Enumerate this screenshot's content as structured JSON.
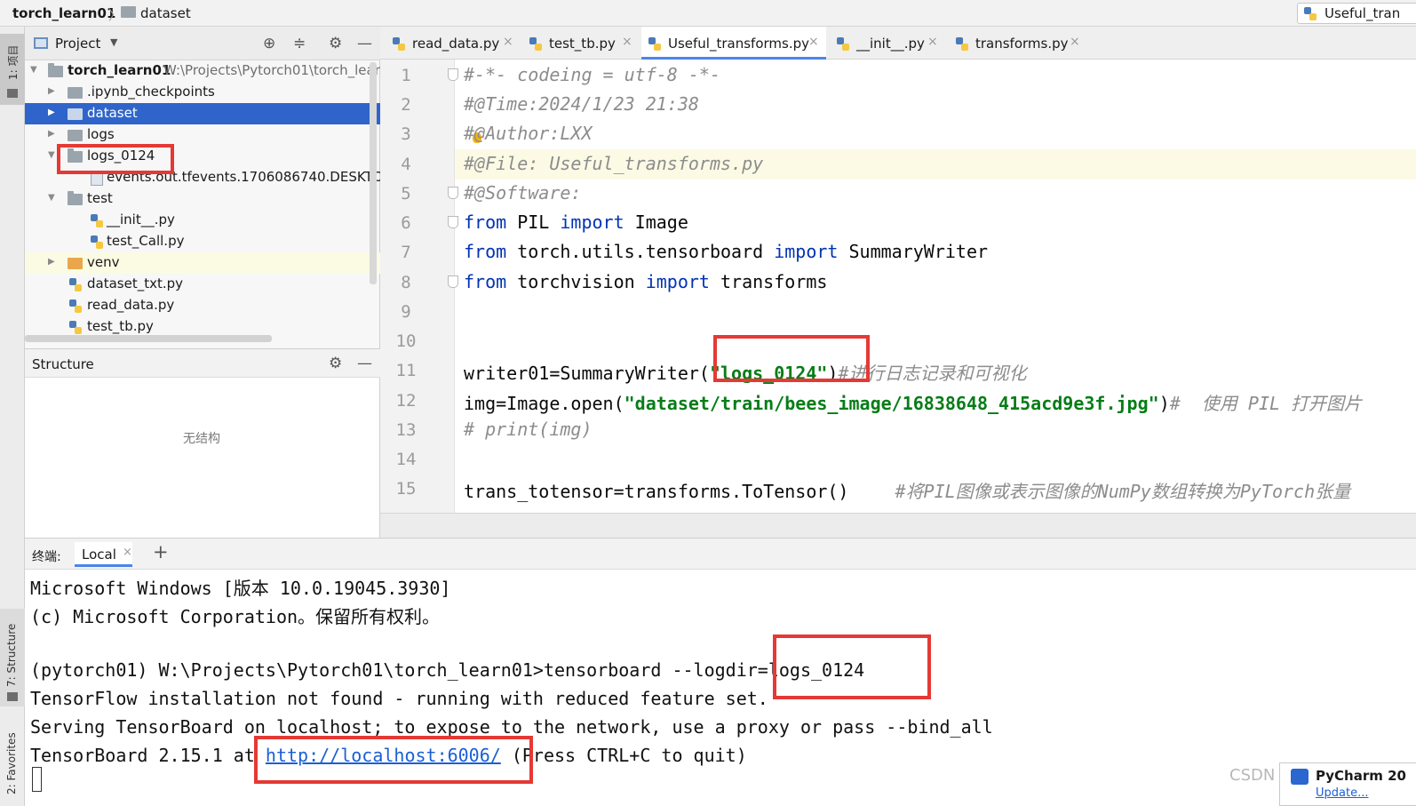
{
  "breadcrumb": {
    "project": "torch_learn01",
    "separator": "〉",
    "folder": "dataset"
  },
  "run_config": {
    "label": "Useful_tran"
  },
  "left_strip": {
    "project_tab": "1: 项目",
    "structure_tab": "7: Structure",
    "favorites_tab": "2: Favorites"
  },
  "project_panel": {
    "title": "Project",
    "tree": [
      {
        "label": "torch_learn01",
        "path": "W:\\Projects\\Pytorch01\\torch_learn",
        "type": "root"
      },
      {
        "label": ".ipynb_checkpoints",
        "type": "folder"
      },
      {
        "label": "dataset",
        "type": "folder",
        "selected": true
      },
      {
        "label": "logs",
        "type": "folder"
      },
      {
        "label": "logs_0124",
        "type": "folder-open"
      },
      {
        "label": "events.out.tfevents.1706086740.DESKTOP-",
        "type": "event-file"
      },
      {
        "label": "test",
        "type": "folder-open"
      },
      {
        "label": "__init__.py",
        "type": "py"
      },
      {
        "label": "test_Call.py",
        "type": "py"
      },
      {
        "label": "venv",
        "type": "folder-orange"
      },
      {
        "label": "dataset_txt.py",
        "type": "py"
      },
      {
        "label": "read_data.py",
        "type": "py"
      },
      {
        "label": "test_tb.py",
        "type": "py"
      }
    ]
  },
  "structure_panel": {
    "title": "Structure",
    "empty_text": "无结构"
  },
  "editor_tabs": [
    {
      "label": "read_data.py",
      "close": "×"
    },
    {
      "label": "test_tb.py",
      "close": "×"
    },
    {
      "label": "Useful_transforms.py",
      "close": "×",
      "active": true
    },
    {
      "label": "__init__.py",
      "close": "×"
    },
    {
      "label": "transforms.py",
      "close": "×"
    }
  ],
  "editor": {
    "line_numbers": [
      "1",
      "2",
      "3",
      "4",
      "5",
      "6",
      "7",
      "8",
      "9",
      "10",
      "11",
      "12",
      "13",
      "14",
      "15"
    ],
    "lines": {
      "l1": "#-*- codeing = utf-8 -*-",
      "l2": "#@Time:2024/1/23 21:38",
      "l3": "#@Author:LXX",
      "l4": "#@File: Useful_transforms.py",
      "l5": "#@Software:",
      "l6_kw1": "from",
      "l6_mod": " PIL ",
      "l6_kw2": "import",
      "l6_name": " Image",
      "l7_kw1": "from",
      "l7_mod": " torch.utils.tensorboard ",
      "l7_kw2": "import",
      "l7_name": " SummaryWriter",
      "l8_kw1": "from",
      "l8_mod": " torchvision ",
      "l8_kw2": "import",
      "l8_name": " transforms",
      "l11_code": "writer01=SummaryWriter(",
      "l11_str": "\"logs_0124\"",
      "l11_end": ")",
      "l11_cm": "#进行日志记录和可视化",
      "l12_code": "img=Image.open(",
      "l12_str": "\"dataset/train/bees_image/16838648_415acd9e3f.jpg\"",
      "l12_end": ")",
      "l12_cm": "#  使用 PIL 打开图片",
      "l13": "# print(img)",
      "l15_code": "trans_totensor=transforms.ToTensor()",
      "l15_cm": "#将PIL图像或表示图像的NumPy数组转换为PyTorch张量"
    }
  },
  "terminal": {
    "label": "终端:",
    "tab": "Local",
    "tab_close": "×",
    "add": "+",
    "lines": {
      "t1": "Microsoft Windows [版本 10.0.19045.3930]",
      "t2": "(c) Microsoft Corporation。保留所有权利。",
      "t4": "(pytorch01) W:\\Projects\\Pytorch01\\torch_learn01>tensorboard --logdir=logs_0124",
      "t5": "TensorFlow installation not found - running with reduced feature set.",
      "t6": "Serving TensorBoard on localhost; to expose to the network, use a proxy or pass --bind_all",
      "t7_pre": "TensorBoard 2.15.1 at ",
      "t7_link": "http://localhost:6006/",
      "t7_post": " (Press CTRL+C to quit)"
    }
  },
  "watermark": "CSDN @",
  "update_popup": {
    "title": "PyCharm 20",
    "link": "Update..."
  }
}
